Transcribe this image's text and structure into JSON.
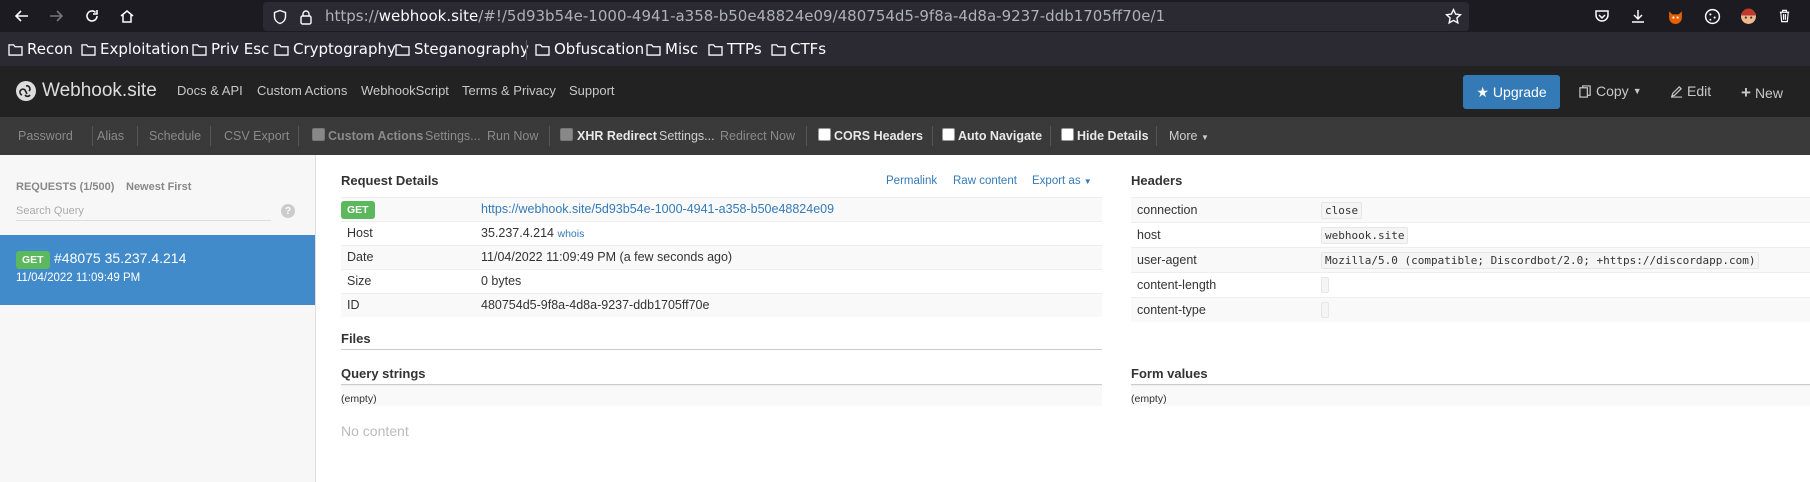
{
  "browser": {
    "url_prefix": "https://",
    "url_host": "webhook.site",
    "url_path": "/#!/5d93b54e-1000-4941-a358-b50e48824e09/480754d5-9f8a-4d8a-9237-ddb1705ff70e/1",
    "bookmarks": [
      "Recon",
      "Exploitation",
      "Priv Esc",
      "Cryptography",
      "Steganography",
      "Obfuscation",
      "Misc",
      "TTPs",
      "CTFs"
    ]
  },
  "app": {
    "logo_text": "Webhook.site",
    "nav": [
      "Docs & API",
      "Custom Actions",
      "WebhookScript",
      "Terms & Privacy",
      "Support"
    ],
    "upgrade_label": "Upgrade",
    "copy_label": "Copy",
    "edit_label": "Edit",
    "new_label": "New"
  },
  "toolbar": {
    "password": "Password",
    "alias": "Alias",
    "schedule": "Schedule",
    "csv_export": "CSV Export",
    "custom_actions": "Custom Actions",
    "ca_settings": "Settings...",
    "run_now": "Run Now",
    "xhr_redirect": "XHR Redirect",
    "xhr_settings": "Settings...",
    "redirect_now": "Redirect Now",
    "cors_headers": "CORS Headers",
    "auto_navigate": "Auto Navigate",
    "hide_details": "Hide Details",
    "more": "More"
  },
  "sidebar": {
    "requests_count": "REQUESTS (1/500)",
    "sort_label": "Newest First",
    "search_placeholder": "Search Query",
    "help": "?",
    "request": {
      "method": "GET",
      "title": "#48075 35.237.4.214",
      "date": "11/04/2022 11:09:49 PM"
    }
  },
  "request_details": {
    "heading": "Request Details",
    "permalink": "Permalink",
    "raw_content": "Raw content",
    "export_as": "Export as",
    "method": "GET",
    "url": "https://webhook.site/5d93b54e-1000-4941-a358-b50e48824e09",
    "host_label": "Host",
    "host_value": "35.237.4.214",
    "whois": "whois",
    "date_label": "Date",
    "date_value": "11/04/2022 11:09:49 PM (a few seconds ago)",
    "size_label": "Size",
    "size_value": "0 bytes",
    "id_label": "ID",
    "id_value": "480754d5-9f8a-4d8a-9237-ddb1705ff70e"
  },
  "files_heading": "Files",
  "query_strings": {
    "heading": "Query strings",
    "empty": "(empty)"
  },
  "no_content": "No content",
  "headers": {
    "heading": "Headers",
    "rows": [
      {
        "name": "connection",
        "value": "close"
      },
      {
        "name": "host",
        "value": "webhook.site"
      },
      {
        "name": "user-agent",
        "value": "Mozilla/5.0 (compatible; Discordbot/2.0; +https://discordapp.com)"
      },
      {
        "name": "content-length",
        "value": ""
      },
      {
        "name": "content-type",
        "value": ""
      }
    ]
  },
  "form_values": {
    "heading": "Form values",
    "empty": "(empty)"
  }
}
